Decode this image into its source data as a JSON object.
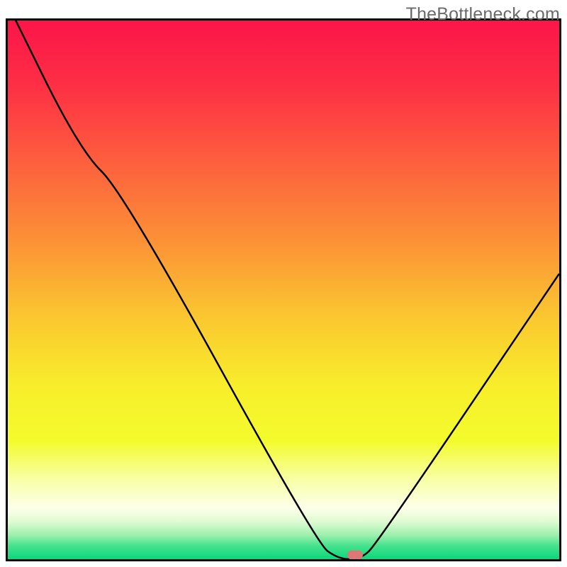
{
  "watermark": "TheBottleneck.com",
  "chart_data": {
    "type": "line",
    "title": "",
    "xlabel": "",
    "ylabel": "",
    "xlim": [
      0,
      100
    ],
    "ylim": [
      0,
      100
    ],
    "series": [
      {
        "name": "bottleneck-curve",
        "x": [
          0,
          13,
          21,
          56,
          60,
          64,
          67,
          100
        ],
        "values": [
          103,
          76,
          68,
          3,
          0,
          0,
          3,
          53
        ]
      }
    ],
    "marker": {
      "x": 63,
      "y": 0.8,
      "color": "#dd7879"
    },
    "gradient_stops": [
      {
        "pos": 0.0,
        "color": "#fc1549"
      },
      {
        "pos": 0.12,
        "color": "#fd2f45"
      },
      {
        "pos": 0.25,
        "color": "#fd5b3e"
      },
      {
        "pos": 0.4,
        "color": "#fc8e37"
      },
      {
        "pos": 0.55,
        "color": "#fac730"
      },
      {
        "pos": 0.68,
        "color": "#f8ee2b"
      },
      {
        "pos": 0.78,
        "color": "#f3fb2c"
      },
      {
        "pos": 0.85,
        "color": "#f8ffa3"
      },
      {
        "pos": 0.905,
        "color": "#fdffe9"
      },
      {
        "pos": 0.93,
        "color": "#e0fbd3"
      },
      {
        "pos": 0.955,
        "color": "#9ef0ae"
      },
      {
        "pos": 0.975,
        "color": "#46e28d"
      },
      {
        "pos": 1.0,
        "color": "#0ad77c"
      }
    ]
  }
}
